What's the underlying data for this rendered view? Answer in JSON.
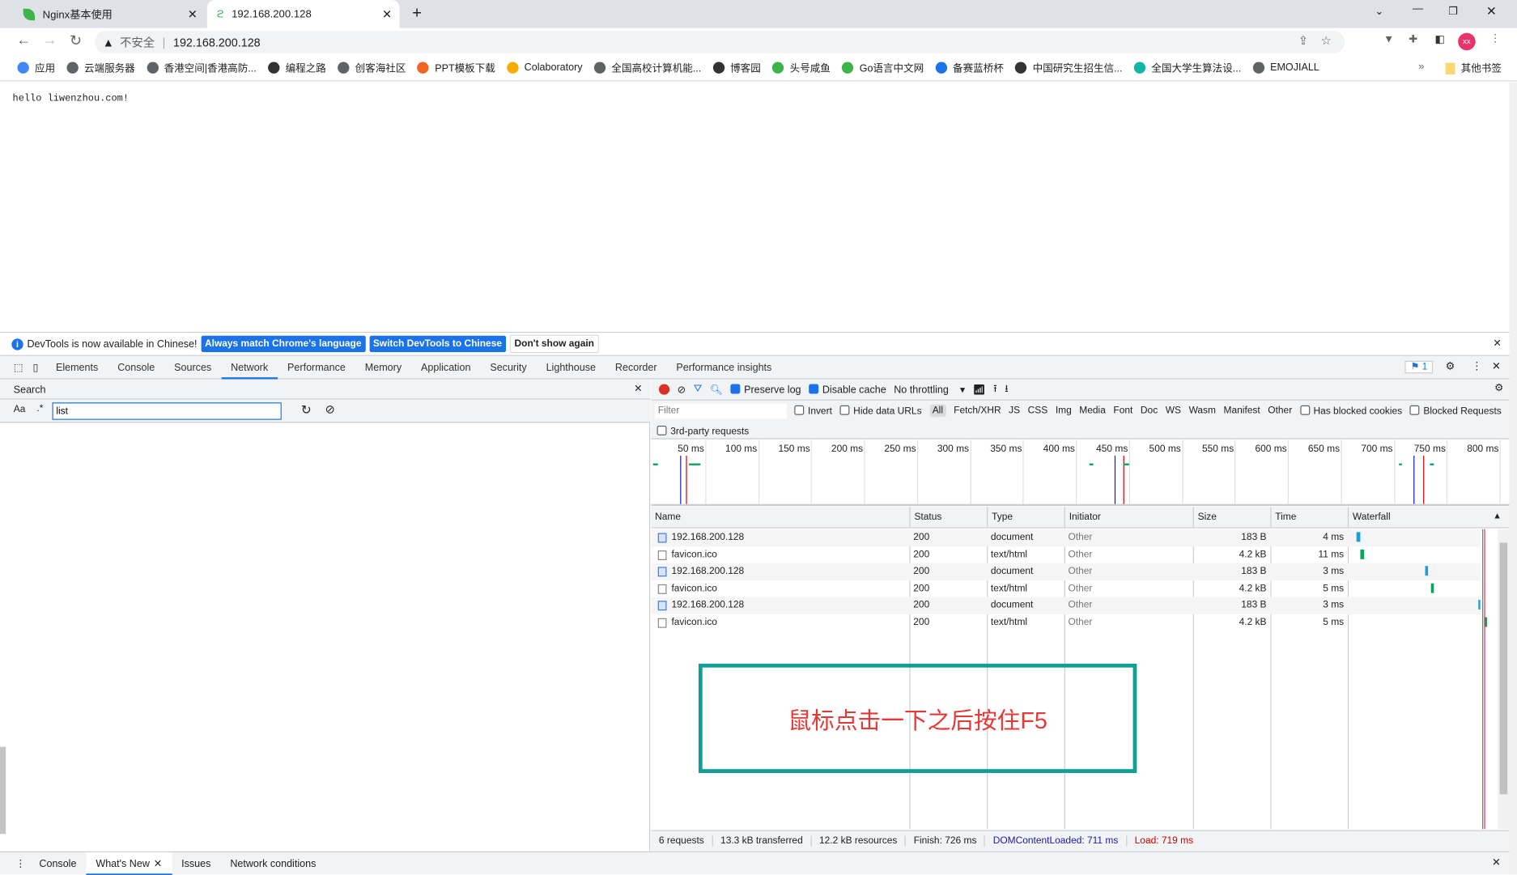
{
  "browser": {
    "tabs": [
      {
        "title": "Nginx基本使用",
        "active": false
      },
      {
        "title": "192.168.200.128",
        "active": true
      }
    ],
    "address": {
      "security_label": "不安全",
      "url": "192.168.200.128"
    },
    "bookmarks": [
      "应用",
      "云端服务器",
      "香港空间|香港高防...",
      "编程之路",
      "创客海社区",
      "PPT模板下载",
      "Colaboratory",
      "全国高校计算机能...",
      "博客园",
      "头号咸鱼",
      "Go语言中文网",
      "备赛蓝桥杯",
      "中国研究生招生信...",
      "全国大学生算法设...",
      "EMOJIALL"
    ],
    "other_bookmarks": "其他书签",
    "profile_initials": "xx"
  },
  "page": {
    "text": "hello liwenzhou.com!"
  },
  "devtools": {
    "infobar": {
      "message": "DevTools is now available in Chinese!",
      "btn_match": "Always match Chrome's language",
      "btn_switch": "Switch DevTools to Chinese",
      "btn_dismiss": "Don't show again"
    },
    "tabs": [
      "Elements",
      "Console",
      "Sources",
      "Network",
      "Performance",
      "Memory",
      "Application",
      "Security",
      "Lighthouse",
      "Recorder",
      "Performance insights"
    ],
    "selected_tab": "Network",
    "issues_count": "1",
    "search": {
      "title": "Search",
      "case_label": "Aa",
      "regex_label": ".*",
      "query": "list"
    },
    "network": {
      "preserve_log": "Preserve log",
      "preserve_log_checked": true,
      "disable_cache": "Disable cache",
      "disable_cache_checked": true,
      "throttling": "No throttling",
      "filter_placeholder": "Filter",
      "invert": "Invert",
      "hide_data_urls": "Hide data URLs",
      "types": [
        "All",
        "Fetch/XHR",
        "JS",
        "CSS",
        "Img",
        "Media",
        "Font",
        "Doc",
        "WS",
        "Wasm",
        "Manifest",
        "Other"
      ],
      "has_blocked_cookies": "Has blocked cookies",
      "blocked_requests": "Blocked Requests",
      "third_party": "3rd-party requests",
      "timeline_ticks": [
        "50 ms",
        "100 ms",
        "150 ms",
        "200 ms",
        "250 ms",
        "300 ms",
        "350 ms",
        "400 ms",
        "450 ms",
        "500 ms",
        "550 ms",
        "600 ms",
        "650 ms",
        "700 ms",
        "750 ms",
        "800 ms"
      ],
      "columns": [
        "Name",
        "Status",
        "Type",
        "Initiator",
        "Size",
        "Time",
        "Waterfall"
      ],
      "rows": [
        {
          "name": "192.168.200.128",
          "status": "200",
          "type": "document",
          "initiator": "Other",
          "size": "183 B",
          "time": "4 ms",
          "icon": "document-icon"
        },
        {
          "name": "favicon.ico",
          "status": "200",
          "type": "text/html",
          "initiator": "Other",
          "size": "4.2 kB",
          "time": "11 ms",
          "icon": "file-icon"
        },
        {
          "name": "192.168.200.128",
          "status": "200",
          "type": "document",
          "initiator": "Other",
          "size": "183 B",
          "time": "3 ms",
          "icon": "document-icon"
        },
        {
          "name": "favicon.ico",
          "status": "200",
          "type": "text/html",
          "initiator": "Other",
          "size": "4.2 kB",
          "time": "5 ms",
          "icon": "file-icon"
        },
        {
          "name": "192.168.200.128",
          "status": "200",
          "type": "document",
          "initiator": "Other",
          "size": "183 B",
          "time": "3 ms",
          "icon": "document-icon"
        },
        {
          "name": "favicon.ico",
          "status": "200",
          "type": "text/html",
          "initiator": "Other",
          "size": "4.2 kB",
          "time": "5 ms",
          "icon": "file-icon"
        }
      ],
      "summary": {
        "requests": "6 requests",
        "transferred": "13.3 kB transferred",
        "resources": "12.2 kB resources",
        "finish": "Finish: 726 ms",
        "dcl": "DOMContentLoaded: 711 ms",
        "load": "Load: 719 ms"
      }
    },
    "drawer_tabs": [
      "Console",
      "What's New",
      "Issues",
      "Network conditions"
    ]
  },
  "annotation": {
    "text": "鼠标点击一下之后按住F5",
    "border_color": "#109f96",
    "text_color": "#e53935"
  },
  "colors": {
    "accent": "#1a73e8",
    "record": "#d93025",
    "dcl": "#1a1aa6",
    "load": "#c80000"
  }
}
